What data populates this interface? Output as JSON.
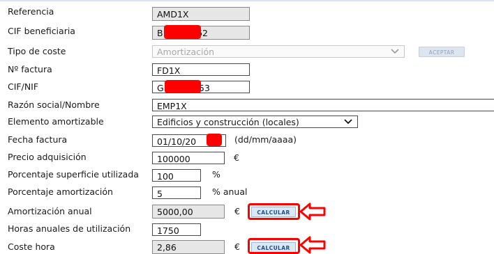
{
  "form": {
    "referencia": {
      "label": "Referencia",
      "value": "AMD1X"
    },
    "cif_beneficiario": {
      "label": "CIF beneficiaria",
      "value_prefix": "B",
      "value_suffix": "62"
    },
    "tipo_coste": {
      "label": "Tipo de coste",
      "selected": "Amortización",
      "accept_label": "ACEPTAR"
    },
    "n_factura": {
      "label": "Nº factura",
      "value": "FD1X"
    },
    "cif_nif": {
      "label": "CIF/NIF",
      "value_prefix": "G",
      "value_suffix": "53"
    },
    "razon_social": {
      "label": "Razón social/Nombre",
      "value": "EMP1X"
    },
    "elemento_amortizable": {
      "label": "Elemento amortizable",
      "selected": "Edificios y construcción (locales)"
    },
    "fecha_factura": {
      "label": "Fecha factura",
      "value": "01/10/20",
      "hint": "(dd/mm/aaaa)"
    },
    "precio_adquisicion": {
      "label": "Precio adquisición",
      "value": "100000",
      "unit": "€"
    },
    "porcentaje_superficie": {
      "label": "Porcentaje superficie utilizada",
      "value": "100",
      "unit": "%"
    },
    "porcentaje_amortizacion": {
      "label": "Porcentaje amortización",
      "value": "5",
      "unit": "% anual"
    },
    "amortizacion_anual": {
      "label": "Amortización anual",
      "value": "5000,00",
      "unit": "€",
      "calc_label": "CALCULAR"
    },
    "horas_anuales": {
      "label": "Horas anuales de utilización",
      "value": "1750"
    },
    "coste_hora": {
      "label": "Coste hora",
      "value": "2,86",
      "unit": "€",
      "calc_label": "CALCULAR"
    }
  },
  "colors": {
    "annotation_red": "#ff0000",
    "readonly_bg": "#e6e6e6",
    "button_text": "#1d4f94"
  }
}
